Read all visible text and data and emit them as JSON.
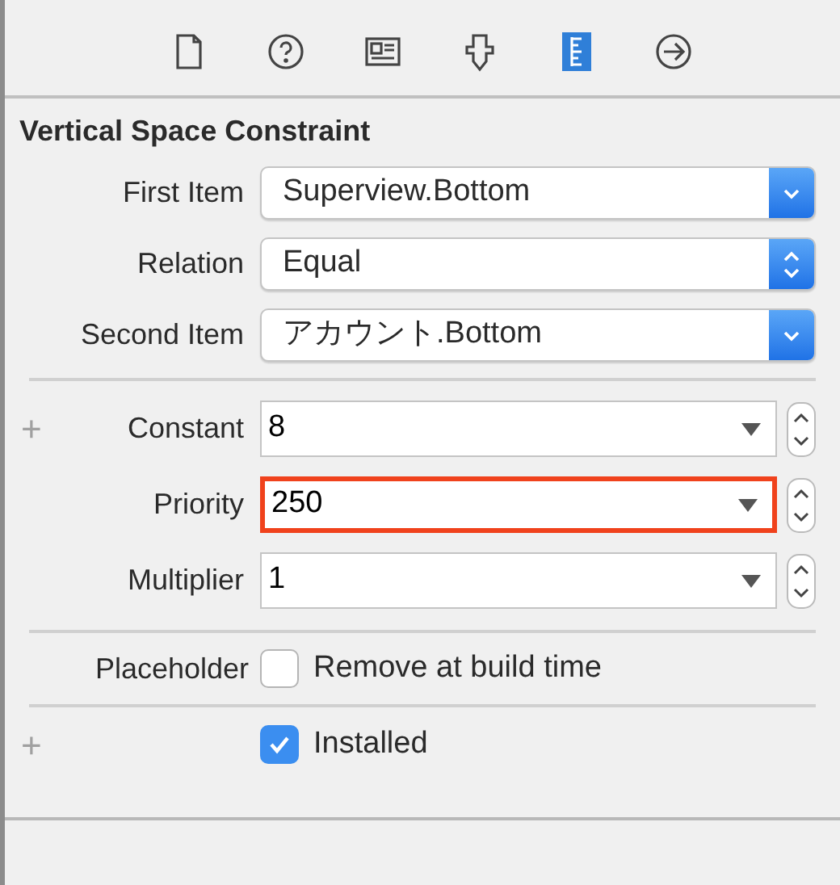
{
  "toolbar": [
    {
      "kind": "file",
      "selected": false
    },
    {
      "kind": "help",
      "selected": false
    },
    {
      "kind": "identity",
      "selected": false
    },
    {
      "kind": "attributes",
      "selected": false
    },
    {
      "kind": "size",
      "selected": true
    },
    {
      "kind": "connections",
      "selected": false
    }
  ],
  "title": "Vertical Space Constraint",
  "popups": [
    {
      "label": "First Item",
      "value": "Superview.Bottom",
      "kind": "pulldown"
    },
    {
      "label": "Relation",
      "value": "Equal",
      "kind": "updown"
    },
    {
      "label": "Second Item",
      "value": "アカウント.Bottom",
      "kind": "pulldown"
    }
  ],
  "fields": [
    {
      "plus": "+",
      "label": "Constant",
      "value": "8",
      "highlighted": false
    },
    {
      "label": "Priority",
      "value": "250",
      "highlighted": true
    },
    {
      "label": "Multiplier",
      "value": "1",
      "highlighted": false
    }
  ],
  "placeholder": {
    "label": "Placeholder",
    "text": "Remove at build time",
    "checked": false
  },
  "installed": {
    "plus": "+",
    "text": "Installed",
    "checked": true
  }
}
